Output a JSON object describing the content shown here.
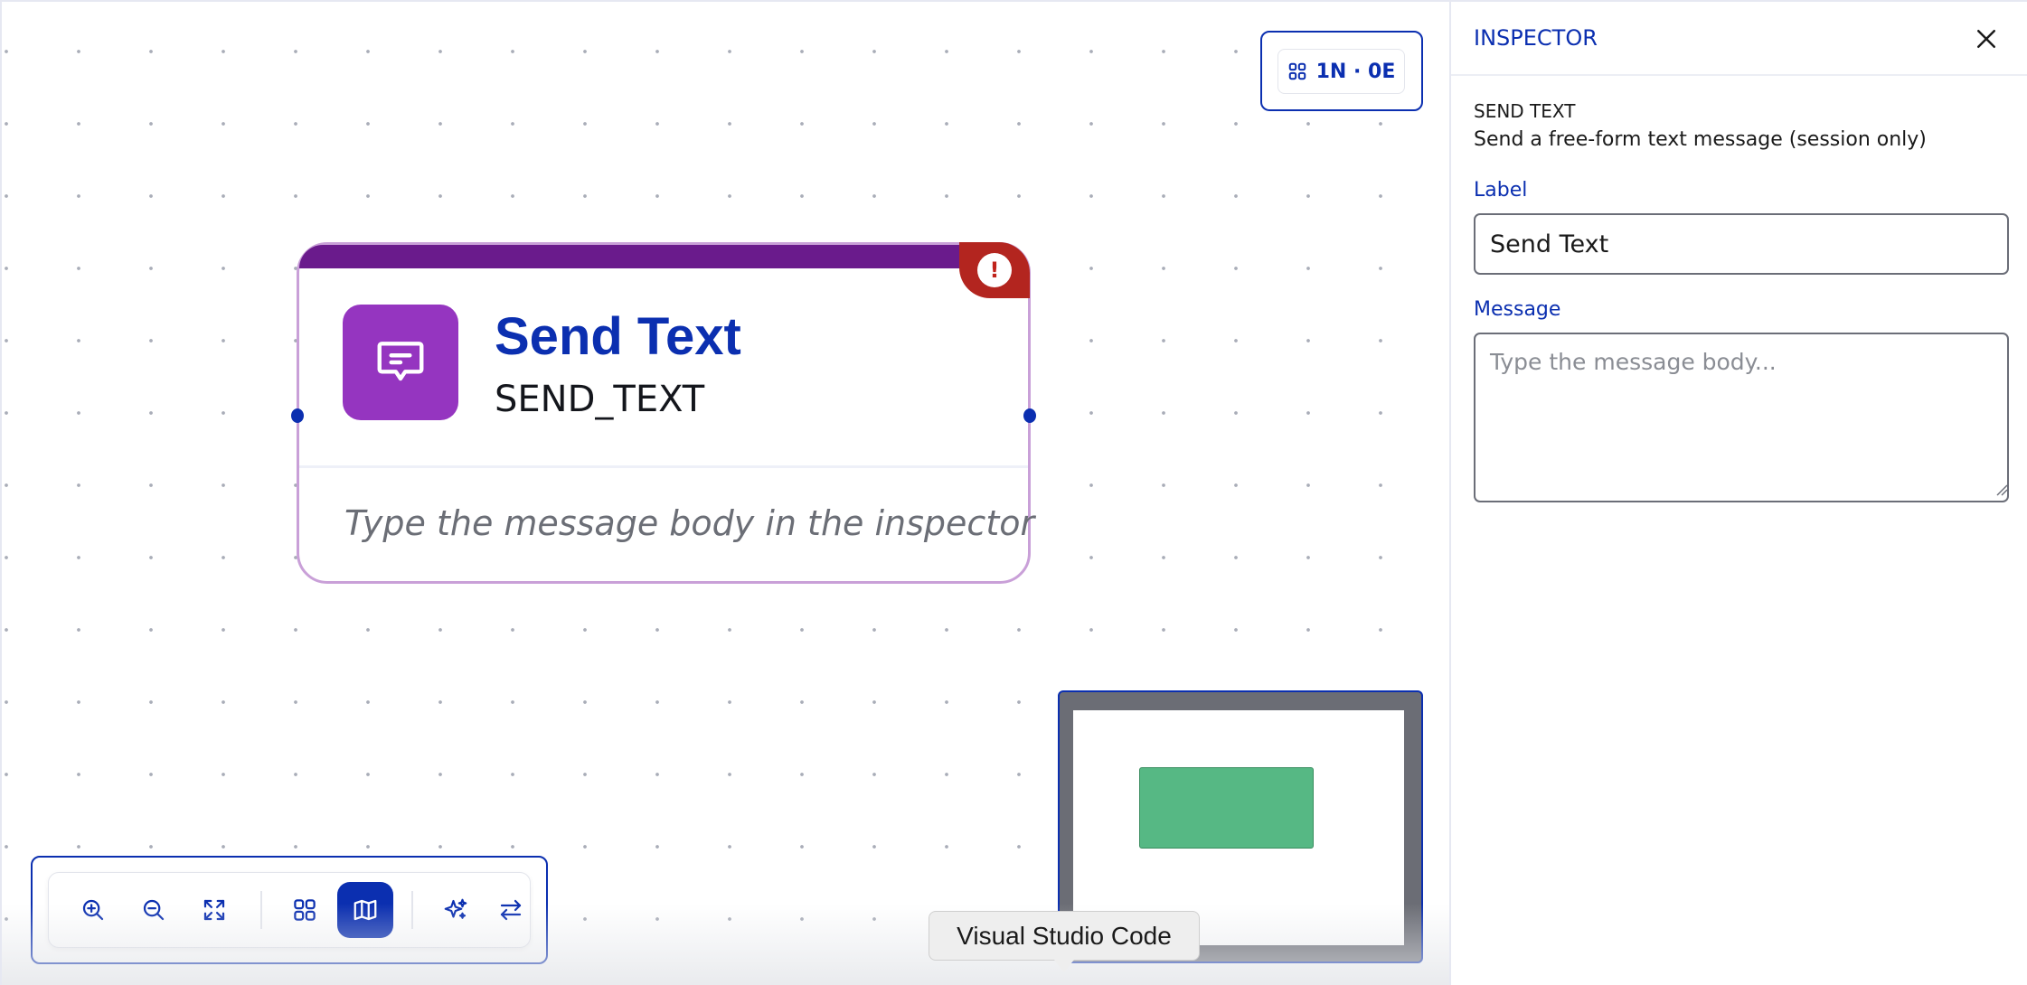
{
  "canvas": {
    "counter": {
      "icon": "grid-icon",
      "label": "1N · 0E"
    },
    "node": {
      "title": "Send Text",
      "type": "SEND_TEXT",
      "hint": "Type the message body in the inspector",
      "icon": "message-icon",
      "error_mark": "!",
      "header_color": "#6a1b8c",
      "icon_color": "#9535c0",
      "error_color": "#b3251f"
    },
    "toolbar": {
      "buttons": [
        {
          "name": "zoom-in",
          "icon": "zoom-in-icon"
        },
        {
          "name": "zoom-out",
          "icon": "zoom-out-icon"
        },
        {
          "name": "fit-view",
          "icon": "fit-view-icon"
        },
        {
          "name": "layout-grid",
          "icon": "grid-icon"
        },
        {
          "name": "minimap-toggle",
          "icon": "map-icon",
          "active": true
        },
        {
          "name": "ai-assist",
          "icon": "sparkles-icon"
        },
        {
          "name": "swap-direction",
          "icon": "arrows-swap-icon"
        }
      ]
    },
    "minimap": {
      "node_color": "#56b884"
    },
    "tooltip": "Visual Studio Code"
  },
  "inspector": {
    "title": "INSPECTOR",
    "close_icon": "close-icon",
    "node_kind": "SEND TEXT",
    "description": "Send a free-form text message (session only)",
    "fields": {
      "label": {
        "label": "Label",
        "value": "Send Text"
      },
      "message": {
        "label": "Message",
        "value": "",
        "placeholder": "Type the message body..."
      }
    }
  },
  "colors": {
    "accent": "#0b2fb0"
  }
}
